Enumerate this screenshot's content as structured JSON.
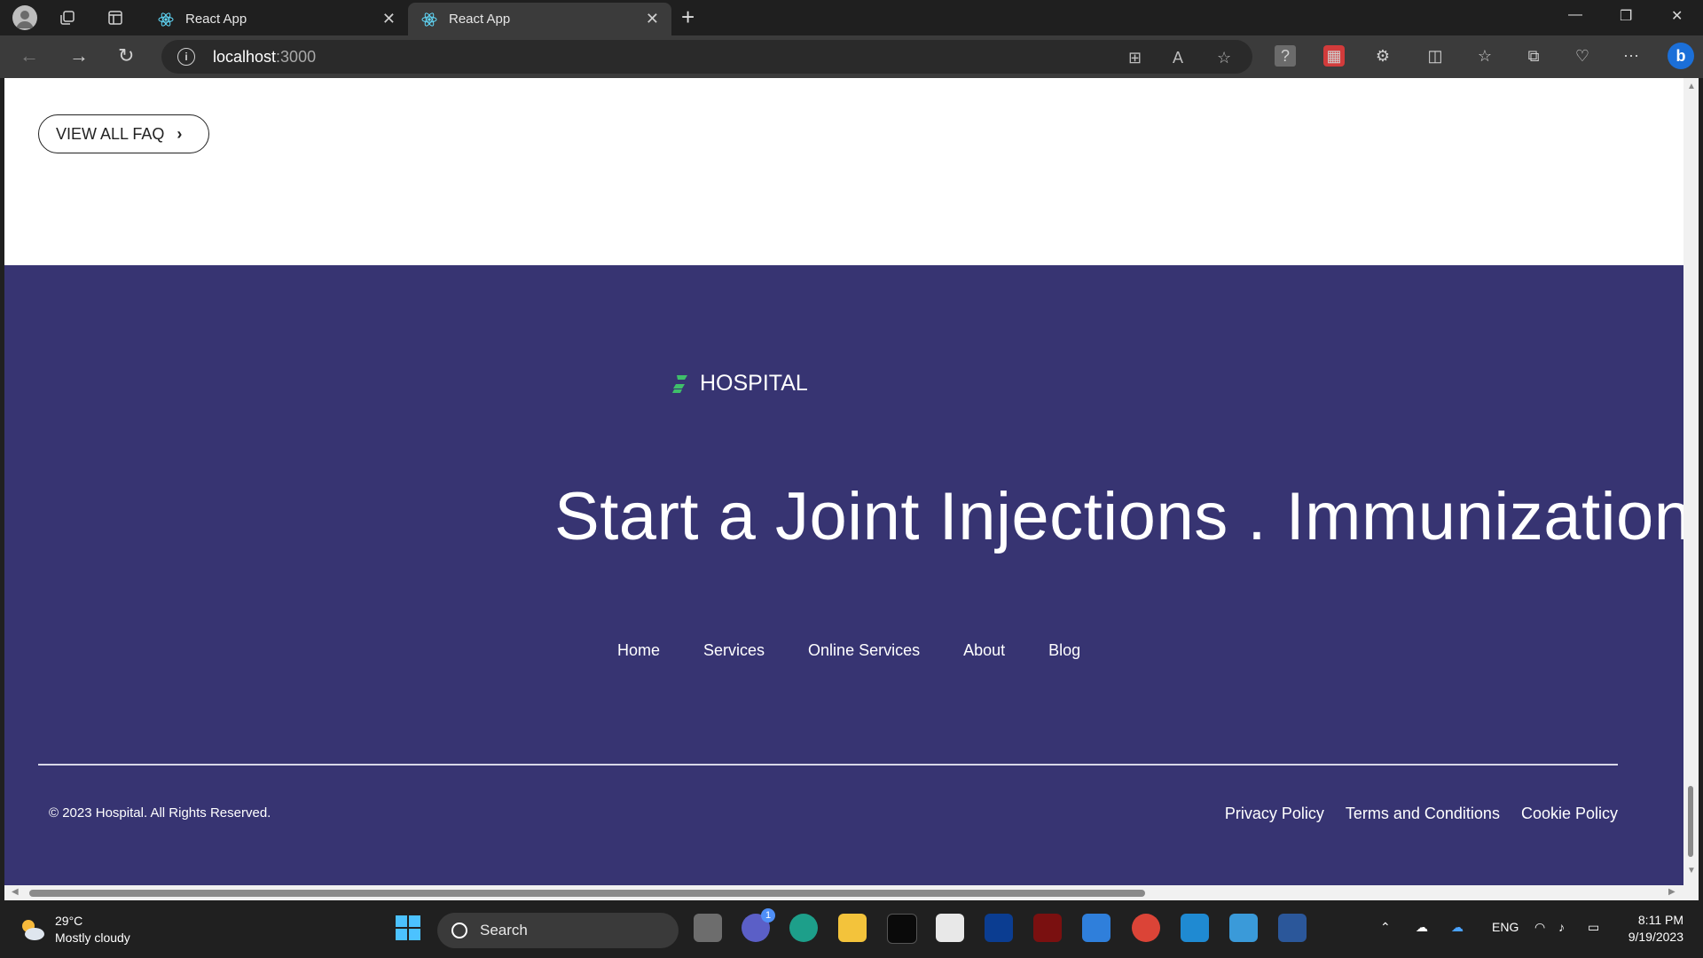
{
  "browser": {
    "tabs": [
      {
        "title": "React App",
        "active": false
      },
      {
        "title": "React App",
        "active": true
      }
    ],
    "address": {
      "host": "localhost",
      "port": ":3000"
    }
  },
  "page": {
    "faq_button": "VIEW ALL FAQ",
    "footer": {
      "brand": "HOSPITAL",
      "marquee": "Start a Joint Injections . Immunizations",
      "menu": [
        "Home",
        "Services",
        "Online Services",
        "About",
        "Blog"
      ],
      "copyright": "© 2023 Hospital. All Rights Reserved.",
      "legal": [
        "Privacy Policy",
        "Terms and Conditions",
        "Cookie Policy"
      ],
      "colors": {
        "background": "#373472",
        "logo_accent": "#3fbf6a"
      }
    }
  },
  "taskbar": {
    "weather": {
      "temp": "29°C",
      "condition": "Mostly cloudy"
    },
    "search_placeholder": "Search",
    "chat_badge": "1",
    "language": "ENG",
    "time": "8:11 PM",
    "date": "9/19/2023"
  }
}
